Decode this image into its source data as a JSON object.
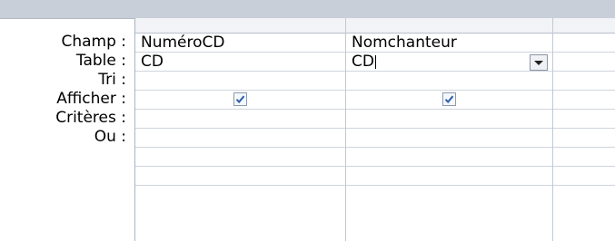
{
  "row_labels": [
    "Champ :",
    "Table :",
    "Tri :",
    "Afficher :",
    "Critères :",
    "Ou :"
  ],
  "columns": [
    {
      "champ": "NuméroCD",
      "table": "CD",
      "tri": "",
      "afficher": true,
      "criteres": "",
      "ou": ""
    },
    {
      "champ": "Nomchanteur",
      "table": "CD",
      "tri": "",
      "afficher": true,
      "criteres": "",
      "ou": ""
    },
    {
      "champ": "",
      "table": "",
      "tri": "",
      "afficher": false,
      "criteres": "",
      "ou": ""
    }
  ],
  "icons": {
    "checkbox": "checkbox-checked-icon",
    "dropdown": "chevron-down-icon"
  }
}
